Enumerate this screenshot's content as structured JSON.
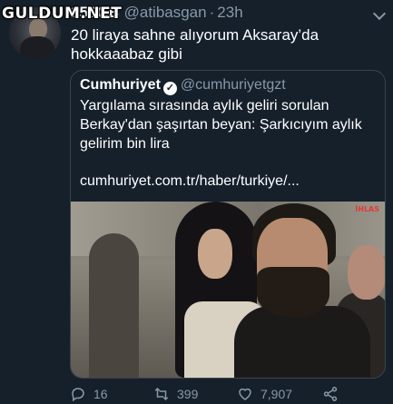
{
  "watermark": "GULDUM.NET",
  "tweet": {
    "display_name": "256GB",
    "handle": "@atibasgan",
    "separator": "·",
    "time": "23h",
    "text_line1": "20 liraya sahne alıyorum Aksaray’da",
    "text_line2": "hokkaaabaz gibi"
  },
  "quoted": {
    "display_name": "Cumhuriyet",
    "verified_mark": "✓",
    "handle": "@cumhuriyetgzt",
    "text_line1": "Yargılama sırasında aylık geliri sorulan",
    "text_line2": "Berkay'dan şaşırtan beyan: Şarkıcıyım aylık",
    "text_line3": "gelirim bin lira",
    "link": "cumhuriyet.com.tr/haber/turkiye/...",
    "photo_tag": "İHLAS"
  },
  "actions": {
    "replies": "16",
    "retweets": "399",
    "likes": "7,907"
  },
  "colors": {
    "background": "#15202b",
    "secondary_text": "#8899a6",
    "border": "#38444d"
  },
  "icons": [
    "reply-icon",
    "retweet-icon",
    "like-icon",
    "share-icon",
    "caret-down-icon",
    "verified-badge-icon"
  ]
}
